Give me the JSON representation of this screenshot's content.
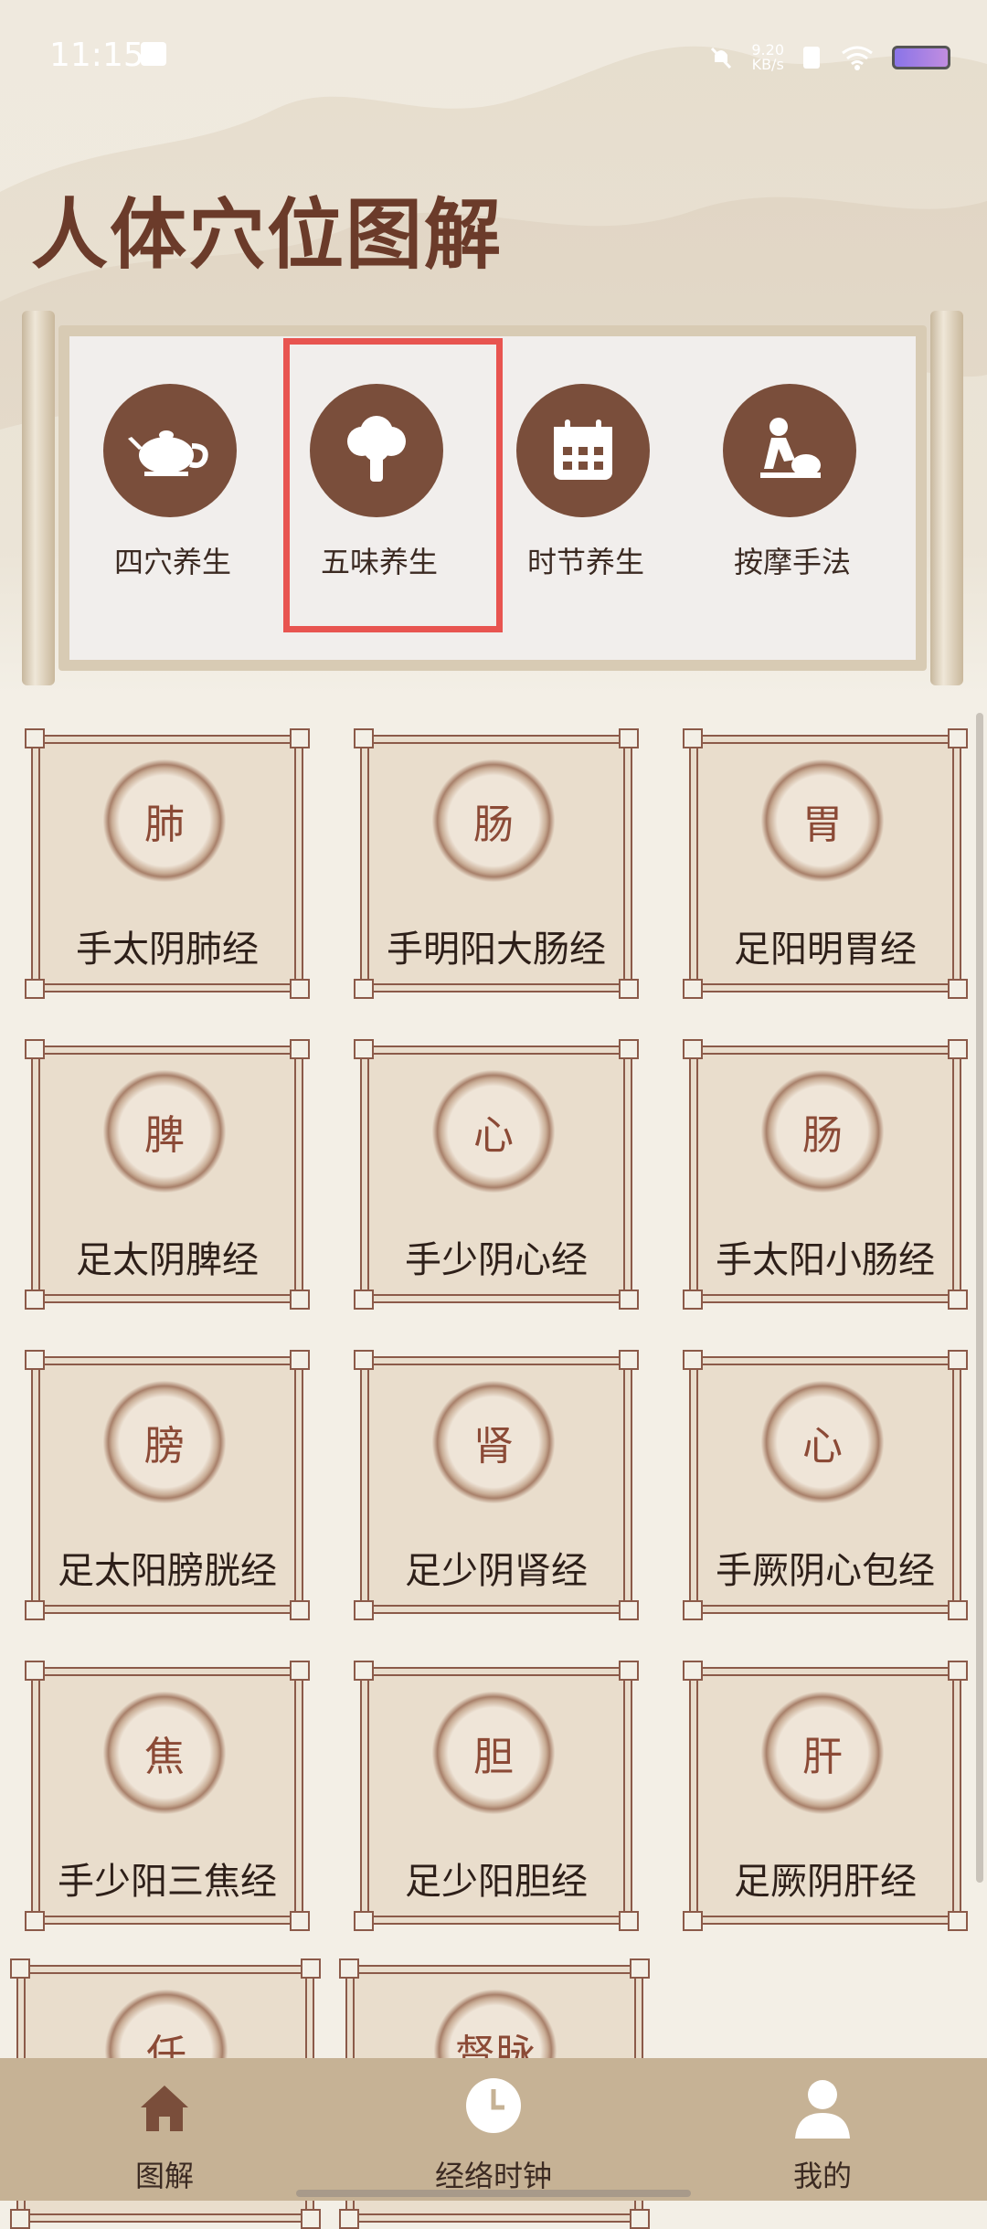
{
  "status": {
    "time": "11:15",
    "speed": "9.20\nKB/s"
  },
  "title": "人体穴位图解",
  "features": [
    {
      "label": "四穴养生",
      "icon": "teapot-icon"
    },
    {
      "label": "五味养生",
      "icon": "broccoli-icon"
    },
    {
      "label": "时节养生",
      "icon": "calendar-icon"
    },
    {
      "label": "按摩手法",
      "icon": "massage-icon"
    }
  ],
  "meridians": [
    {
      "seal": "肺",
      "name": "手太阴肺经"
    },
    {
      "seal": "肠",
      "name": "手明阳大肠经"
    },
    {
      "seal": "胃",
      "name": "足阳明胃经"
    },
    {
      "seal": "脾",
      "name": "足太阴脾经"
    },
    {
      "seal": "心",
      "name": "手少阴心经"
    },
    {
      "seal": "肠",
      "name": "手太阳小肠经"
    },
    {
      "seal": "膀",
      "name": "足太阳膀胱经"
    },
    {
      "seal": "肾",
      "name": "足少阴肾经"
    },
    {
      "seal": "心",
      "name": "手厥阴心包经"
    },
    {
      "seal": "焦",
      "name": "手少阳三焦经"
    },
    {
      "seal": "胆",
      "name": "足少阳胆经"
    },
    {
      "seal": "肝",
      "name": "足厥阴肝经"
    },
    {
      "seal": "任",
      "name": ""
    },
    {
      "seal": "督脉",
      "name": ""
    }
  ],
  "tabs": [
    {
      "label": "图解",
      "icon": "home-icon"
    },
    {
      "label": "经络时钟",
      "icon": "clock-icon"
    },
    {
      "label": "我的",
      "icon": "user-icon"
    }
  ],
  "colors": {
    "accent": "#7a4e3b",
    "highlight": "#e85450",
    "tabbar": "#c6b295"
  }
}
